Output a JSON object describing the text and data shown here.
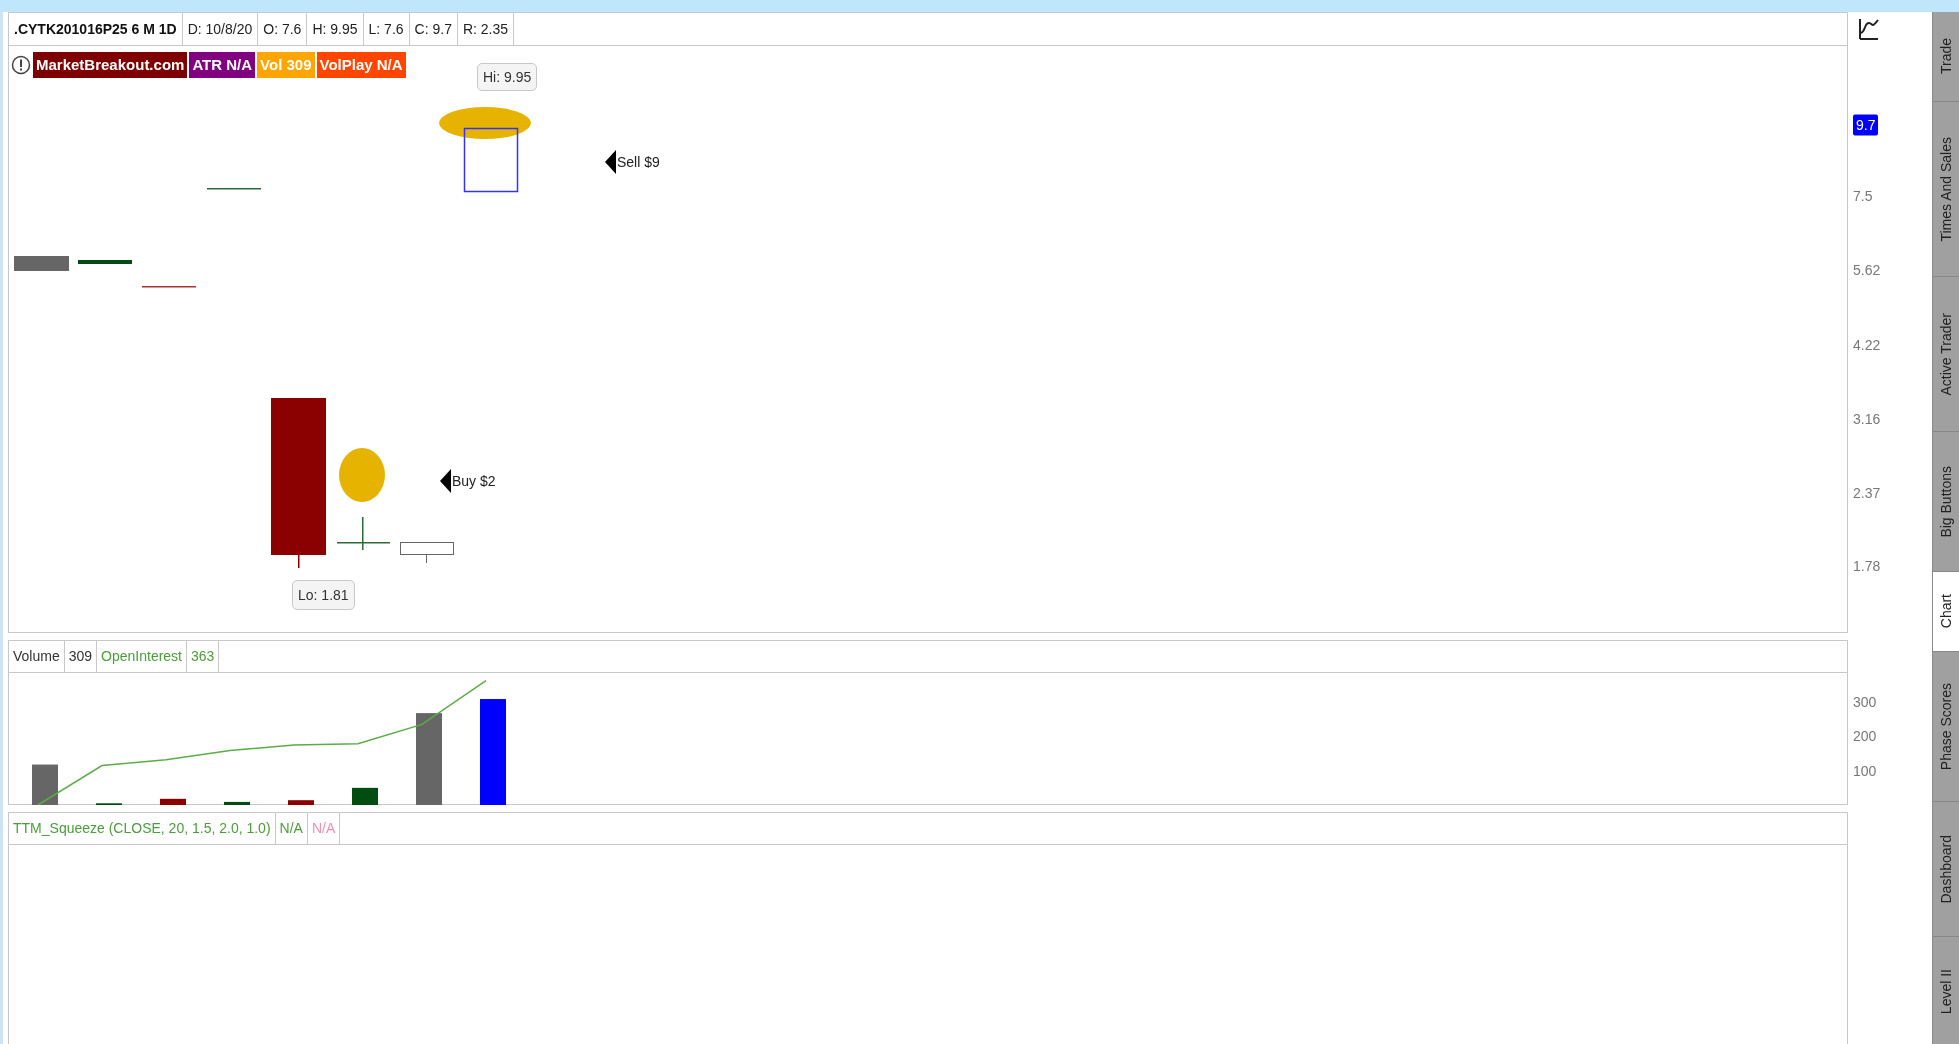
{
  "header": {
    "symbol": ".CYTK201016P25 6 M 1D",
    "fields": [
      "D: 10/8/20",
      "O: 7.6",
      "H: 9.95",
      "L: 7.6",
      "C: 9.7",
      "R: 2.35"
    ]
  },
  "studies": [
    {
      "label": "MarketBreakout.com",
      "color": "#7f0000"
    },
    {
      "label": "ATR N/A",
      "color": "#800080"
    },
    {
      "label": "Vol 309",
      "color": "#ffa500"
    },
    {
      "label": "VolPlay N/A",
      "color": "#ff4500"
    }
  ],
  "price_chart": {
    "high_label": "Hi: 9.95",
    "low_label": "Lo: 1.81",
    "orders": [
      {
        "kind": "sell",
        "label": "Sell $9"
      },
      {
        "kind": "buy",
        "label": "Buy $2"
      }
    ],
    "last_price": "9.7",
    "axis_ticks": [
      "7.5",
      "5.62",
      "4.22",
      "3.16",
      "2.37",
      "1.78"
    ]
  },
  "volume": {
    "labels": [
      {
        "text": "Volume",
        "color": "#333333"
      },
      {
        "text": "309",
        "color": "#333333"
      },
      {
        "text": "OpenInterest",
        "color": "#4a9e3a"
      },
      {
        "text": "363",
        "color": "#4a9e3a"
      }
    ],
    "axis_ticks": [
      "300",
      "200",
      "100"
    ]
  },
  "ttm": {
    "labels": [
      {
        "text": "TTM_Squeeze (CLOSE, 20, 1.5, 2.0, 1.0)",
        "color": "#4a9e3a"
      },
      {
        "text": "N/A",
        "color": "#4a9e3a"
      },
      {
        "text": "N/A",
        "color": "#f090b0"
      }
    ]
  },
  "side_tabs": [
    {
      "label": "Trade",
      "selected": false
    },
    {
      "label": "Times And Sales",
      "selected": false
    },
    {
      "label": "Active Trader",
      "selected": false
    },
    {
      "label": "Big Buttons",
      "selected": false
    },
    {
      "label": "Chart",
      "selected": true
    },
    {
      "label": "Phase Scores",
      "selected": false
    },
    {
      "label": "Dashboard",
      "selected": false
    },
    {
      "label": "Level II",
      "selected": false
    }
  ]
}
